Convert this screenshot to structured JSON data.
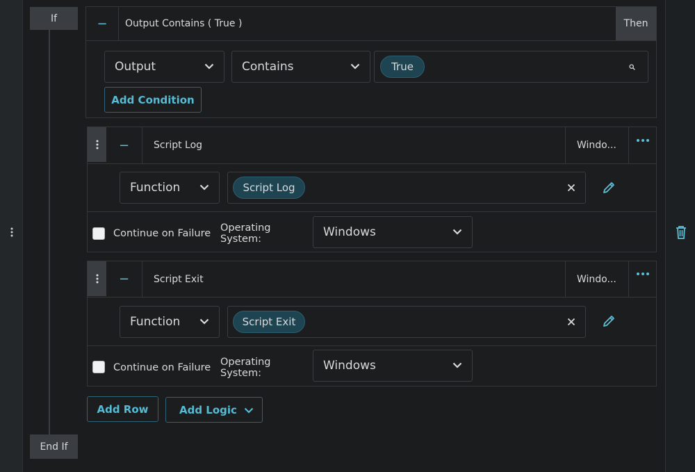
{
  "block": {
    "if_label": "If",
    "end_if_label": "End If",
    "then_label": "Then"
  },
  "condition": {
    "header": "Output Contains ( True )",
    "collapse_symbol": "−",
    "field_select": "Output",
    "operator_select": "Contains",
    "value_chip": "True",
    "add_condition_label": "Add Condition"
  },
  "rows": [
    {
      "header": "Script Log",
      "os_short": "Windo...",
      "collapse_symbol": "−",
      "type_select": "Function",
      "function_chip": "Script Log",
      "continue_on_failure_label": "Continue on Failure",
      "os_label": "Operating System:",
      "os_select": "Windows"
    },
    {
      "header": "Script Exit",
      "os_short": "Windo...",
      "collapse_symbol": "−",
      "type_select": "Function",
      "function_chip": "Script Exit",
      "continue_on_failure_label": "Continue on Failure",
      "os_label": "Operating System:",
      "os_select": "Windows"
    }
  ],
  "footer": {
    "add_row_label": "Add Row",
    "add_logic_label": "Add Logic"
  },
  "colors": {
    "accent": "#5dc0d8",
    "background": "#1a1c1e",
    "chip": "#1e4452"
  },
  "icons": [
    "vertical-dots-icon",
    "chevron-down-icon",
    "search-icon",
    "close-icon",
    "pencil-icon",
    "more-horizontal-icon",
    "trash-icon",
    "minus-icon"
  ]
}
